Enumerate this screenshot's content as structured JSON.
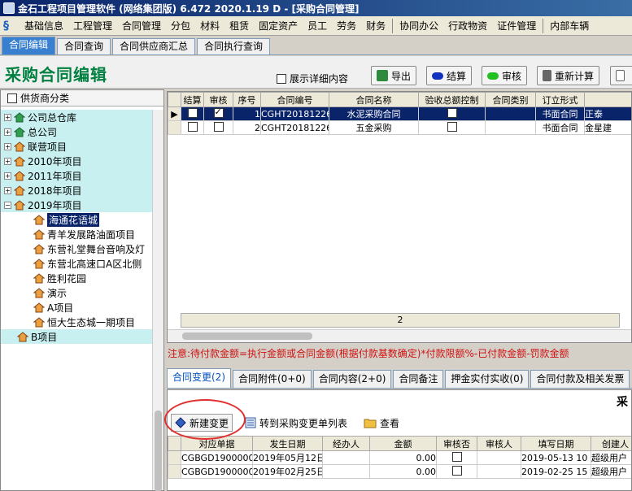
{
  "window": {
    "title": "金石工程项目管理软件 (网络集团版) 6.472   2020.1.19 D - [采购合同管理]"
  },
  "menu": [
    "基础信息",
    "工程管理",
    "合同管理",
    "分包",
    "材料",
    "租赁",
    "固定资产",
    "员工",
    "劳务",
    "财务",
    "协同办公",
    "行政物资",
    "证件管理",
    "内部车辆"
  ],
  "tabs": [
    {
      "label": "合同编辑",
      "active": true
    },
    {
      "label": "合同查询"
    },
    {
      "label": "合同供应商汇总"
    },
    {
      "label": "合同执行查询"
    }
  ],
  "header": {
    "title": "采购合同编辑",
    "show_detail_label": "展示详细内容",
    "buttons": {
      "export": "导出",
      "settle": "结算",
      "audit": "审核",
      "recalc": "重新计算"
    }
  },
  "sidebar": {
    "header_label": "供货商分类",
    "roots": [
      {
        "label": "公司总仓库",
        "green": true
      },
      {
        "label": "总公司",
        "green": true
      },
      {
        "label": "联营项目"
      },
      {
        "label": "2010年项目"
      },
      {
        "label": "2011年项目"
      },
      {
        "label": "2018年项目"
      },
      {
        "label": "2019年项目",
        "expanded": true
      }
    ],
    "children": [
      "海通花语城",
      "青羊发展路油面项目",
      "东营礼堂舞台音响及灯",
      "东营北高速口A区北侧",
      "胜利花园",
      "演示",
      "A项目",
      "恒大生态城一期项目"
    ],
    "last_root": "B项目"
  },
  "contracts": {
    "columns": [
      "结算",
      "审核",
      "序号",
      "合同编号",
      "合同名称",
      "验收总额控制",
      "合同类别",
      "订立形式",
      ""
    ],
    "rows": [
      {
        "seq": "1",
        "code": "CGHT2018122601",
        "name": "水泥采购合同",
        "form": "书面合同",
        "extra": "正泰",
        "audited": true
      },
      {
        "seq": "2",
        "code": "CGHT2018122602",
        "name": "五金采购",
        "form": "书面合同",
        "extra": "金星建",
        "audited": false
      }
    ],
    "count": "2"
  },
  "note": "注意:待付款金额=执行金额或合同金额(根据付款基数确定)*付款限额%-已付款金额-罚款金额",
  "subtabs": [
    "合同变更(2)",
    "合同附件(0+0)",
    "合同内容(2+0)",
    "合同备注",
    "押金实付实收(0)",
    "合同付款及相关发票"
  ],
  "subpanel": {
    "title": "采",
    "buttons": {
      "new_change": "新建变更",
      "goto_list": "转到采购变更单列表",
      "view": "查看"
    },
    "columns": [
      "对应单据",
      "发生日期",
      "经办人",
      "金额",
      "审核否",
      "审核人",
      "填写日期",
      "创建人"
    ],
    "rows": [
      {
        "doc": "CGBGD190000008",
        "date": "2019年05月12日",
        "amount": "0.00",
        "fill_date": "2019-05-13 10",
        "creator": "超级用户"
      },
      {
        "doc": "CGBGD190000006",
        "date": "2019年02月25日",
        "amount": "0.00",
        "fill_date": "2019-02-25 15",
        "creator": "超级用户"
      }
    ]
  },
  "colors": {
    "title_green": "#008040",
    "selection": "#0a246a",
    "tree_bg": "#c8f0f0",
    "note_red": "#d01010",
    "highlight_circle": "#e03030"
  }
}
